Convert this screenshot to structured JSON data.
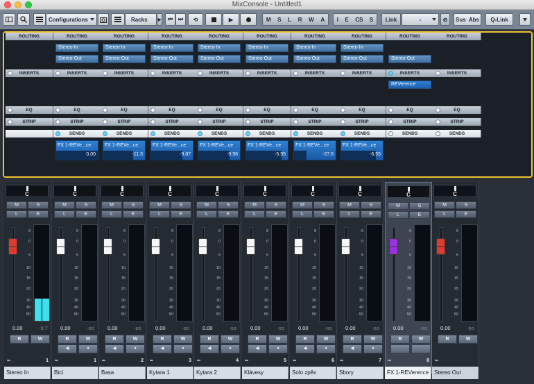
{
  "window": {
    "title": "MixConsole - Untitled1"
  },
  "toolbar": {
    "configurations": "Configurations",
    "racks": "Racks",
    "modes": [
      "M",
      "S",
      "L",
      "R",
      "W",
      "A"
    ],
    "modes2": [
      "I",
      "E",
      "CS",
      "S"
    ],
    "link": "Link",
    "link_value": "-",
    "sus": "Sus",
    "abs": "Abs",
    "qlink": "Q-Link"
  },
  "racks": {
    "routing": "ROUTING",
    "inserts": "INSERTS",
    "eq": "EQ",
    "strip": "STRIP",
    "sends": "SENDS"
  },
  "channels": [
    {
      "num": "1",
      "name": "Stereo In",
      "pan": "C",
      "volume": "0.00",
      "peak": "-9.7",
      "routing_in": "",
      "routing_out": "",
      "insert": "",
      "send_name": "",
      "send_val": ""
    },
    {
      "num": "1",
      "name": "Bicí",
      "pan": "C",
      "volume": "0.00",
      "peak": "-oo",
      "routing_in": "Stereo In",
      "routing_out": "Stereo Out",
      "insert": "",
      "send_name": "FX 1-REVe...ce",
      "send_val": "0.00"
    },
    {
      "num": "2",
      "name": "Basa",
      "pan": "C",
      "volume": "0.00",
      "peak": "-oo",
      "routing_in": "Stereo In",
      "routing_out": "Stereo Out",
      "insert": "",
      "send_name": "FX 1-REVe...ce",
      "send_val": "-11.3"
    },
    {
      "num": "3",
      "name": "Kytara 1",
      "pan": "C",
      "volume": "0.00",
      "peak": "-oo",
      "routing_in": "Stereo In",
      "routing_out": "Stereo Out",
      "insert": "",
      "send_name": "FX 1-REVe...ce",
      "send_val": "-9.87"
    },
    {
      "num": "4",
      "name": "Kytara 2",
      "pan": "C",
      "volume": "0.00",
      "peak": "-oo",
      "routing_in": "Stereo In",
      "routing_out": "Stereo Out",
      "insert": "",
      "send_name": "FX 1-REVe...ce",
      "send_val": "-9.98"
    },
    {
      "num": "5",
      "name": "Klávesy",
      "pan": "C",
      "volume": "0.00",
      "peak": "-oo",
      "routing_in": "Stereo In",
      "routing_out": "Stereo Out",
      "insert": "",
      "send_name": "FX 1-REVe...ce",
      "send_val": "-5.95"
    },
    {
      "num": "6",
      "name": "Solo zpěv",
      "pan": "C",
      "volume": "0.00",
      "peak": "-oo",
      "routing_in": "Stereo In",
      "routing_out": "Stereo Out",
      "insert": "",
      "send_name": "FX 1-REVe...ce",
      "send_val": "-27.8"
    },
    {
      "num": "7",
      "name": "Sbory",
      "pan": "C",
      "volume": "0.00",
      "peak": "-oo",
      "routing_in": "Stereo In",
      "routing_out": "Stereo Out",
      "insert": "",
      "send_name": "FX 1-REVe...ce",
      "send_val": "-6.55"
    },
    {
      "num": "8",
      "name": "FX 1-REVerence",
      "pan": "C",
      "volume": "0.00",
      "peak": "-oo",
      "routing_in": "",
      "routing_out": "Stereo Out",
      "insert": "REVerence",
      "send_name": "",
      "send_val": ""
    },
    {
      "num": "",
      "name": "Stereo Out",
      "pan": "C",
      "volume": "0.00",
      "peak": "-oo",
      "routing_in": "",
      "routing_out": "",
      "insert": "",
      "send_name": "",
      "send_val": ""
    }
  ],
  "scale": [
    "6",
    "0",
    "5",
    "10",
    "15",
    "20",
    "30",
    "40",
    "50"
  ],
  "buttons": {
    "m": "M",
    "s": "S",
    "l": "L",
    "e": "E",
    "r": "R",
    "w": "W"
  },
  "colors": {
    "accent": "#f2c230",
    "send": "#2e7fd0",
    "meter": "#3fe0ee"
  }
}
